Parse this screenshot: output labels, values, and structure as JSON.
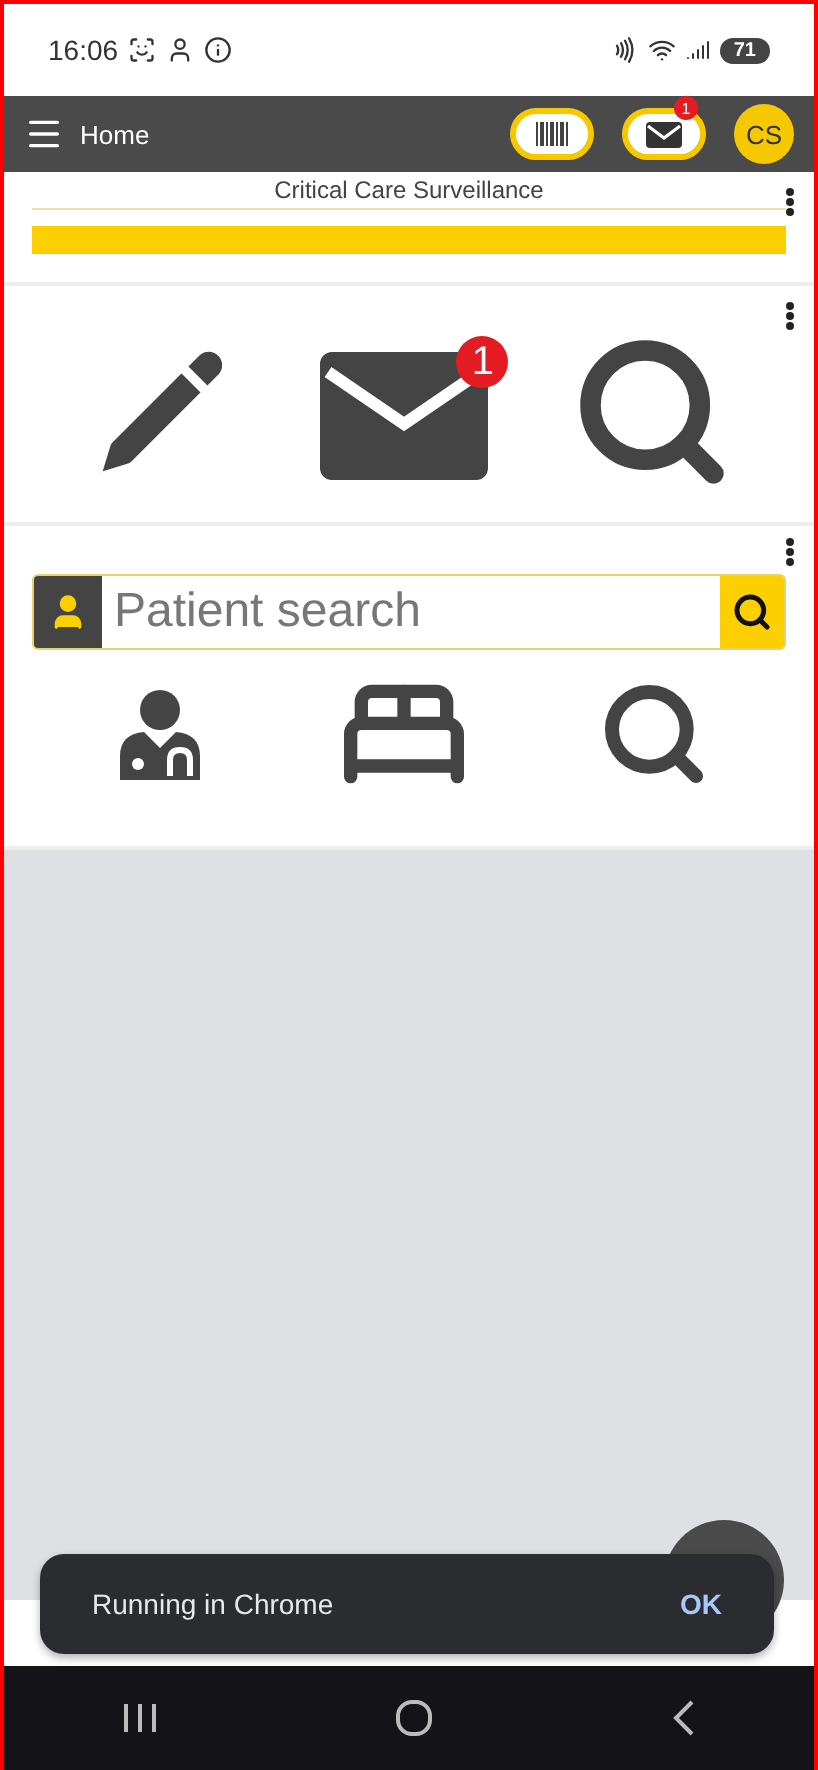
{
  "status_bar": {
    "time": "16:06",
    "battery": "71"
  },
  "app_bar": {
    "title": "Home",
    "mail_badge": "1",
    "avatar": "CS"
  },
  "surveillance_card": {
    "title": "Critical Care Surveillance"
  },
  "shortcuts": {
    "mail_badge": "1"
  },
  "patient_search": {
    "placeholder": "Patient search"
  },
  "snackbar": {
    "message": "Running in Chrome",
    "action": "OK"
  }
}
